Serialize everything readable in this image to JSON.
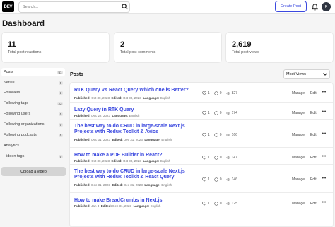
{
  "header": {
    "logo": "DEV",
    "search_placeholder": "Search...",
    "create_post": "Create Post",
    "avatar_initial": "R"
  },
  "page_title": "Dashboard",
  "stats": [
    {
      "value": "11",
      "label": "Total post reactions"
    },
    {
      "value": "2",
      "label": "Total post comments"
    },
    {
      "value": "2,619",
      "label": "Total post views"
    }
  ],
  "sidebar": {
    "items": [
      {
        "label": "Posts",
        "count": "51"
      },
      {
        "label": "Series",
        "count": "0"
      },
      {
        "label": "Followers",
        "count": "3"
      },
      {
        "label": "Following tags",
        "count": "23"
      },
      {
        "label": "Following users",
        "count": "0"
      },
      {
        "label": "Following organizations",
        "count": "0"
      },
      {
        "label": "Following podcasts",
        "count": "0"
      },
      {
        "label": "Analytics",
        "count": ""
      },
      {
        "label": "Hidden tags",
        "count": "0"
      }
    ],
    "upload_label": "Upload a video"
  },
  "posts_heading": "Posts",
  "sort_selected": "Most Views",
  "actions": {
    "manage": "Manage",
    "edit": "Edit",
    "more": "•••"
  },
  "meta_labels": {
    "published": "Published:",
    "edited": "Edited:",
    "language": "Language:"
  },
  "posts": [
    {
      "title": "RTK Query Vs React Query Which one is Better?",
      "published": "Oct 30, 2023",
      "edited": "Oct 30, 2023",
      "language": "English",
      "reactions": "1",
      "comments": "0",
      "views": "827"
    },
    {
      "title": "Lazy Query in RTK Query",
      "published": "Dec 22, 2023",
      "edited": "",
      "language": "English",
      "reactions": "1",
      "comments": "0",
      "views": "174"
    },
    {
      "title": "The best way to do CRUD in large-scale Next.js Projects with Redux Toolkit & Axios",
      "published": "Dec 31, 2023",
      "edited": "Dec 31, 2023",
      "language": "English",
      "reactions": "1",
      "comments": "0",
      "views": "166"
    },
    {
      "title": "How to make a PDF Builder in React?",
      "published": "Oct 30, 2023",
      "edited": "Oct 30, 2023",
      "language": "English",
      "reactions": "1",
      "comments": "0",
      "views": "147"
    },
    {
      "title": "The best way to do CRUD in large-scale Next.js Projects with Redux Toolkit & React Query",
      "published": "Dec 31, 2023",
      "edited": "Dec 31, 2023",
      "language": "English",
      "reactions": "1",
      "comments": "0",
      "views": "146"
    },
    {
      "title": "How to make BreadCrumbs in Next.js",
      "published": "Jan 3",
      "edited": "Dec 31, 2023",
      "language": "English",
      "reactions": "1",
      "comments": "0",
      "views": "125"
    }
  ]
}
